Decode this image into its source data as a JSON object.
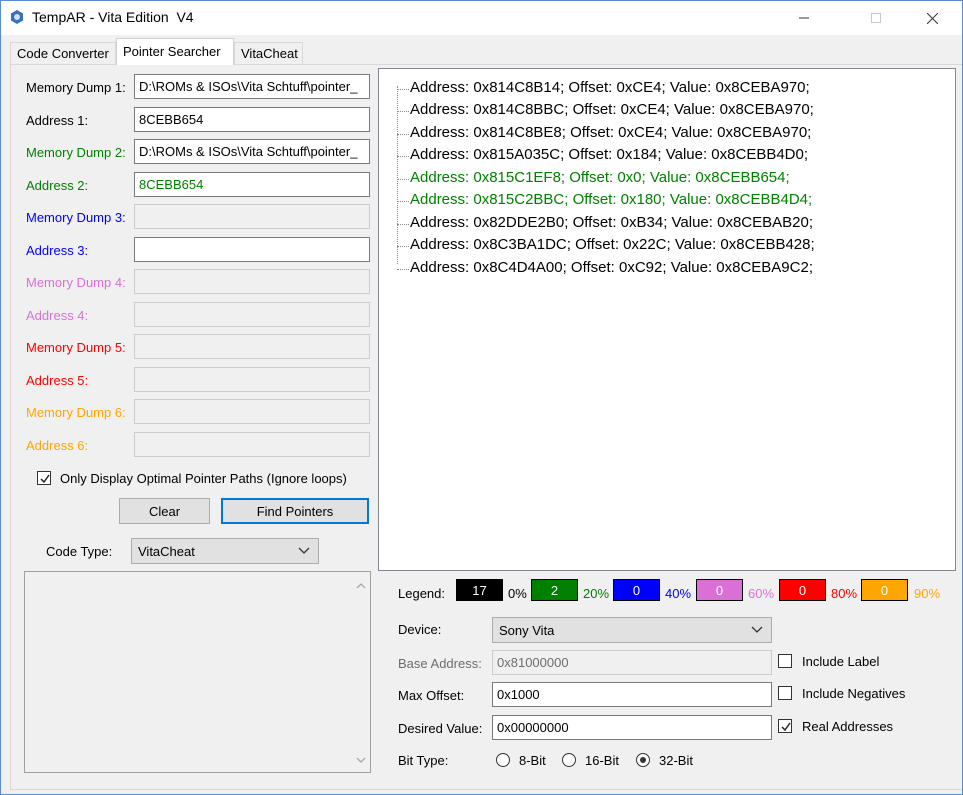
{
  "window": {
    "title": "TempAR - Vita Edition  V4"
  },
  "tabs": [
    {
      "label": "Code Converter"
    },
    {
      "label": "Pointer Searcher"
    },
    {
      "label": "VitaCheat"
    }
  ],
  "dumps": [
    {
      "dump_label": "Memory Dump 1:",
      "address_label": "Address 1:",
      "dump_value": "D:\\ROMs & ISOs\\Vita Schtuff\\pointer_",
      "address_value": "8CEBB654",
      "color": "#000000"
    },
    {
      "dump_label": "Memory Dump 2:",
      "address_label": "Address 2:",
      "dump_value": "D:\\ROMs & ISOs\\Vita Schtuff\\pointer_",
      "address_value": "8CEBB654",
      "color": "#008000"
    },
    {
      "dump_label": "Memory Dump 3:",
      "address_label": "Address 3:",
      "dump_value": "",
      "address_value": "",
      "color": "#0000ff"
    },
    {
      "dump_label": "Memory Dump 4:",
      "address_label": "Address 4:",
      "dump_value": "",
      "address_value": "",
      "color": "#da70d6"
    },
    {
      "dump_label": "Memory Dump 5:",
      "address_label": "Address 5:",
      "dump_value": "",
      "address_value": "",
      "color": "#ff0000"
    },
    {
      "dump_label": "Memory Dump 6:",
      "address_label": "Address 6:",
      "dump_value": "",
      "address_value": "",
      "color": "#ffa500"
    }
  ],
  "optimal_checkbox": {
    "label": "Only Display Optimal Pointer Paths (Ignore loops)",
    "checked": true
  },
  "buttons": {
    "clear": "Clear",
    "find": "Find Pointers"
  },
  "code_type": {
    "label": "Code Type:",
    "value": "VitaCheat"
  },
  "results": [
    {
      "text": "Address: 0x814C8B14; Offset: 0xCE4; Value: 0x8CEBA970;",
      "color": "#000000"
    },
    {
      "text": "Address: 0x814C8BBC; Offset: 0xCE4; Value: 0x8CEBA970;",
      "color": "#000000"
    },
    {
      "text": "Address: 0x814C8BE8; Offset: 0xCE4; Value: 0x8CEBA970;",
      "color": "#000000"
    },
    {
      "text": "Address: 0x815A035C; Offset: 0x184; Value: 0x8CEBB4D0;",
      "color": "#000000"
    },
    {
      "text": "Address: 0x815C1EF8; Offset: 0x0; Value: 0x8CEBB654;",
      "color": "#008000"
    },
    {
      "text": "Address: 0x815C2BBC; Offset: 0x180; Value: 0x8CEBB4D4;",
      "color": "#008000"
    },
    {
      "text": "Address: 0x82DDE2B0; Offset: 0xB34; Value: 0x8CEBAB20;",
      "color": "#000000"
    },
    {
      "text": "Address: 0x8C3BA1DC; Offset: 0x22C; Value: 0x8CEBB428;",
      "color": "#000000"
    },
    {
      "text": "Address: 0x8C4D4A00; Offset: 0xC92; Value: 0x8CEBA9C2;",
      "color": "#000000"
    }
  ],
  "legend": {
    "label": "Legend:",
    "items": [
      {
        "count": "17",
        "pct": "0%",
        "color": "#000000",
        "text_color": "#000000"
      },
      {
        "count": "2",
        "pct": "20%",
        "color": "#008000",
        "text_color": "#008000"
      },
      {
        "count": "0",
        "pct": "40%",
        "color": "#0000ff",
        "text_color": "#0000ff"
      },
      {
        "count": "0",
        "pct": "60%",
        "color": "#da70d6",
        "text_color": "#da70d6"
      },
      {
        "count": "0",
        "pct": "80%",
        "color": "#ff0000",
        "text_color": "#ff0000"
      },
      {
        "count": "0",
        "pct": "90%",
        "color": "#ffa500",
        "text_color": "#ffa500"
      }
    ]
  },
  "settings": {
    "device_label": "Device:",
    "device_value": "Sony Vita",
    "base_label": "Base Address:",
    "base_value": "0x81000000",
    "max_label": "Max Offset:",
    "max_value": "0x1000",
    "desired_label": "Desired Value:",
    "desired_value": "0x00000000",
    "bit_label": "Bit Type:"
  },
  "options": {
    "include_label": {
      "label": "Include Label",
      "checked": false
    },
    "include_negatives": {
      "label": "Include Negatives",
      "checked": false
    },
    "real_addresses": {
      "label": "Real Addresses",
      "checked": true
    }
  },
  "bit_types": [
    {
      "label": "8-Bit",
      "selected": false
    },
    {
      "label": "16-Bit",
      "selected": false
    },
    {
      "label": "32-Bit",
      "selected": true
    }
  ]
}
